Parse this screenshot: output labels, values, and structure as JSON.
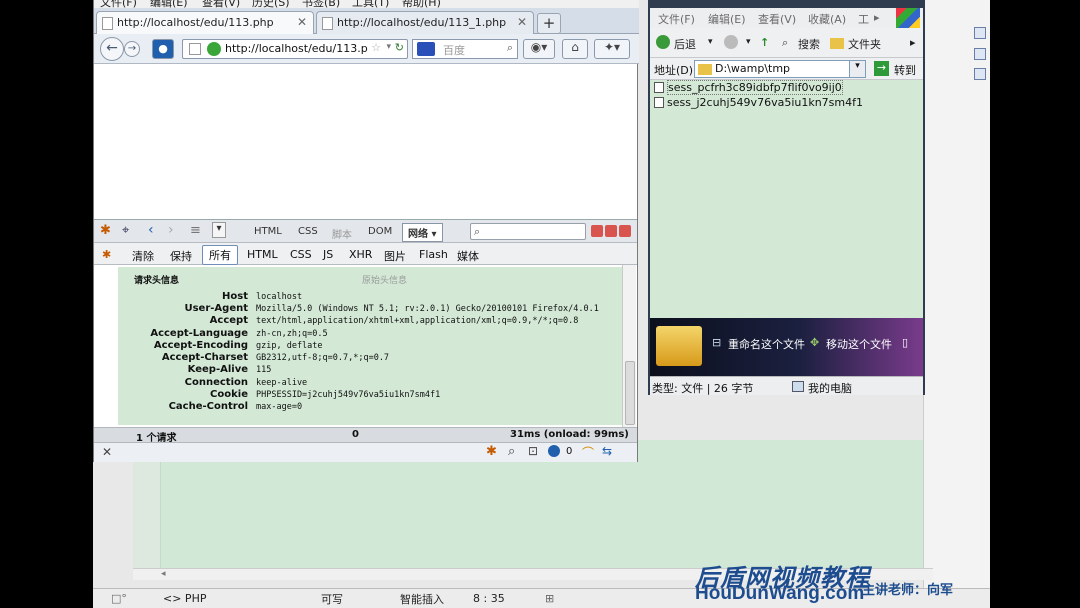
{
  "browser": {
    "menu": [
      "文件(F)",
      "编辑(E)",
      "查看(V)",
      "历史(S)",
      "书签(B)",
      "工具(T)",
      "帮助(H)"
    ],
    "tabs": [
      {
        "label": "http://localhost/edu/113.php",
        "active": true
      },
      {
        "label": "http://localhost/edu/113_1.php",
        "active": false
      }
    ],
    "new_tab": "+",
    "url": "http://localhost/edu/113.p",
    "search_placeholder": "百度"
  },
  "firebug": {
    "toolbar": [
      "HTML",
      "CSS",
      "脚本",
      "DOM",
      "网络 ▾"
    ],
    "tabs": [
      "清除",
      "保持",
      "所有",
      "HTML",
      "CSS",
      "JS",
      "XHR",
      "图片",
      "Flash",
      "媒体"
    ],
    "selected_tab": "所有",
    "section_title": "请求头信息",
    "section_title_right": "原始头信息",
    "headers": [
      {
        "key": "Host",
        "value": "localhost"
      },
      {
        "key": "User-Agent",
        "value": "Mozilla/5.0 (Windows NT 5.1; rv:2.0.1) Gecko/20100101 Firefox/4.0.1"
      },
      {
        "key": "Accept",
        "value": "text/html,application/xhtml+xml,application/xml;q=0.9,*/*;q=0.8"
      },
      {
        "key": "Accept-Language",
        "value": "zh-cn,zh;q=0.5"
      },
      {
        "key": "Accept-Encoding",
        "value": "gzip, deflate"
      },
      {
        "key": "Accept-Charset",
        "value": "GB2312,utf-8;q=0.7,*;q=0.7"
      },
      {
        "key": "Keep-Alive",
        "value": "115"
      },
      {
        "key": "Connection",
        "value": "keep-alive"
      },
      {
        "key": "Cookie",
        "value": "PHPSESSID=j2cuhj549v76va5iu1kn7sm4f1"
      },
      {
        "key": "Cache-Control",
        "value": "max-age=0"
      }
    ],
    "status": {
      "requests": "1 个请求",
      "size": "0",
      "time": "31ms (onload: 99ms)"
    },
    "addon_count": "0",
    "close": "✕"
  },
  "explorer": {
    "menu": [
      "文件(F)",
      "编辑(E)",
      "查看(V)",
      "收藏(A)",
      "工"
    ],
    "toolbar": {
      "back": "后退",
      "search": "搜索",
      "folders": "文件夹"
    },
    "address_label": "地址(D)",
    "address": "D:\\wamp\\tmp",
    "go": "转到",
    "files": [
      "sess_pcfrh3c89idbfp7flif0vo9ij0",
      "sess_j2cuhj549v76va5iu1kn7sm4f1"
    ],
    "preview": {
      "rename": "重命名这个文件",
      "move": "移动这个文件"
    },
    "status": {
      "type": "类型: 文件 | 26 字节",
      "location": "我的电脑"
    }
  },
  "editor": {
    "status": {
      "lang": "<> PHP",
      "mode": "可写",
      "insert": "智能插入",
      "pos": "8 : 35"
    }
  },
  "watermark": {
    "brand": "后盾网视频教程",
    "site": "HouDunWang.com",
    "teacher": "主讲老师：向军"
  }
}
